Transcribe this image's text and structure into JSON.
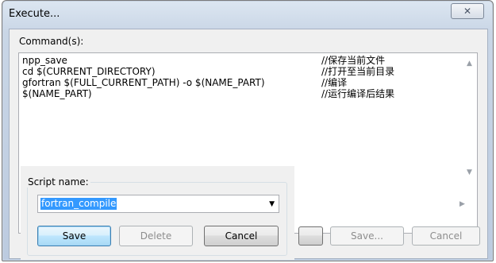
{
  "window": {
    "title": "Execute...",
    "close_icon": "✕"
  },
  "command_label": "Command(s):",
  "commands": [
    {
      "code": "npp_save",
      "comment": "//保存当前文件"
    },
    {
      "code": "cd $(CURRENT_DIRECTORY)",
      "comment": "//打开至当前目录"
    },
    {
      "code": "gfortran $(FULL_CURRENT_PATH) -o $(NAME_PART)",
      "comment": "//编译"
    },
    {
      "code": "$(NAME_PART)",
      "comment": "//运行编译后结果"
    }
  ],
  "main_buttons": {
    "save": "Save...",
    "cancel": "Cancel"
  },
  "script_dialog": {
    "label": "Script name:",
    "value": "fortran_compile",
    "save": "Save",
    "delete": "Delete",
    "cancel": "Cancel"
  },
  "icons": {
    "up": "▲",
    "down": "▼",
    "right": "▶"
  }
}
